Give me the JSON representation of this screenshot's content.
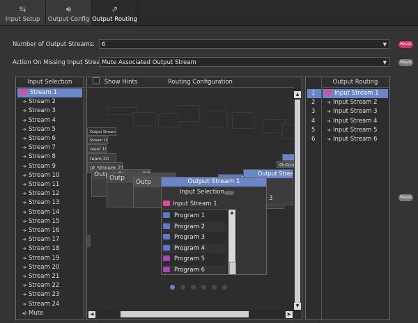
{
  "tabs": [
    {
      "label": "Input Setup",
      "icon": "input-setup-icon"
    },
    {
      "label": "Output Config",
      "icon": "speaker-icon"
    },
    {
      "label": "Output Routing",
      "icon": "routing-icon",
      "active": true
    }
  ],
  "settings": {
    "num_streams_label": "Number of Output Streams:",
    "num_streams_value": "6",
    "missing_label": "Action On Missing Input Stream:",
    "missing_value": "Mute Associated Output Stream",
    "reset_label": "Reset"
  },
  "input_selection": {
    "title": "Input Selection",
    "items": [
      "Stream 1",
      "Stream 2",
      "Stream 3",
      "Stream 4",
      "Stream 5",
      "Stream 6",
      "Stream 7",
      "Stream 8",
      "Stream 9",
      "Stream 10",
      "Stream 11",
      "Stream 12",
      "Stream 13",
      "Stream 14",
      "Stream 15",
      "Stream 16",
      "Stream 17",
      "Stream 18",
      "Stream 19",
      "Stream 20",
      "Stream 21",
      "Stream 22",
      "Stream 23",
      "Stream 24"
    ],
    "mute": "Mute"
  },
  "routing": {
    "show_hints": "Show Hints",
    "title": "Routing Configuration",
    "bg_nodes": [
      "Output Stream 17",
      "Stream 18",
      "ream 19",
      "ream 20",
      "ut Stream 21",
      "Output Stream 22",
      "Outp",
      "Outp",
      "Output Stream 2",
      "tion",
      "m 2",
      "Outpu",
      "Output Stream 3",
      "m 3"
    ],
    "front_node": {
      "title": "Output Stream 1",
      "section": "Input Selection",
      "selected": "Input Stream 1",
      "programs": [
        "Program 1",
        "Program 2",
        "Program 3",
        "Program 4",
        "Program 5",
        "Program 6"
      ]
    }
  },
  "output_routing": {
    "title": "Output Routing",
    "numbers": [
      "1",
      "2",
      "3",
      "4",
      "5",
      "6"
    ],
    "items": [
      "Input Stream 1",
      "Input Stream 2",
      "Input Stream 3",
      "Input Stream 4",
      "Input Stream 5",
      "Input Stream 6"
    ]
  },
  "colors": {
    "accent": "#6a86c8",
    "reset": "#d6305e",
    "program_blue": "#5a7cc8",
    "program_purple": "#a04ab0"
  }
}
